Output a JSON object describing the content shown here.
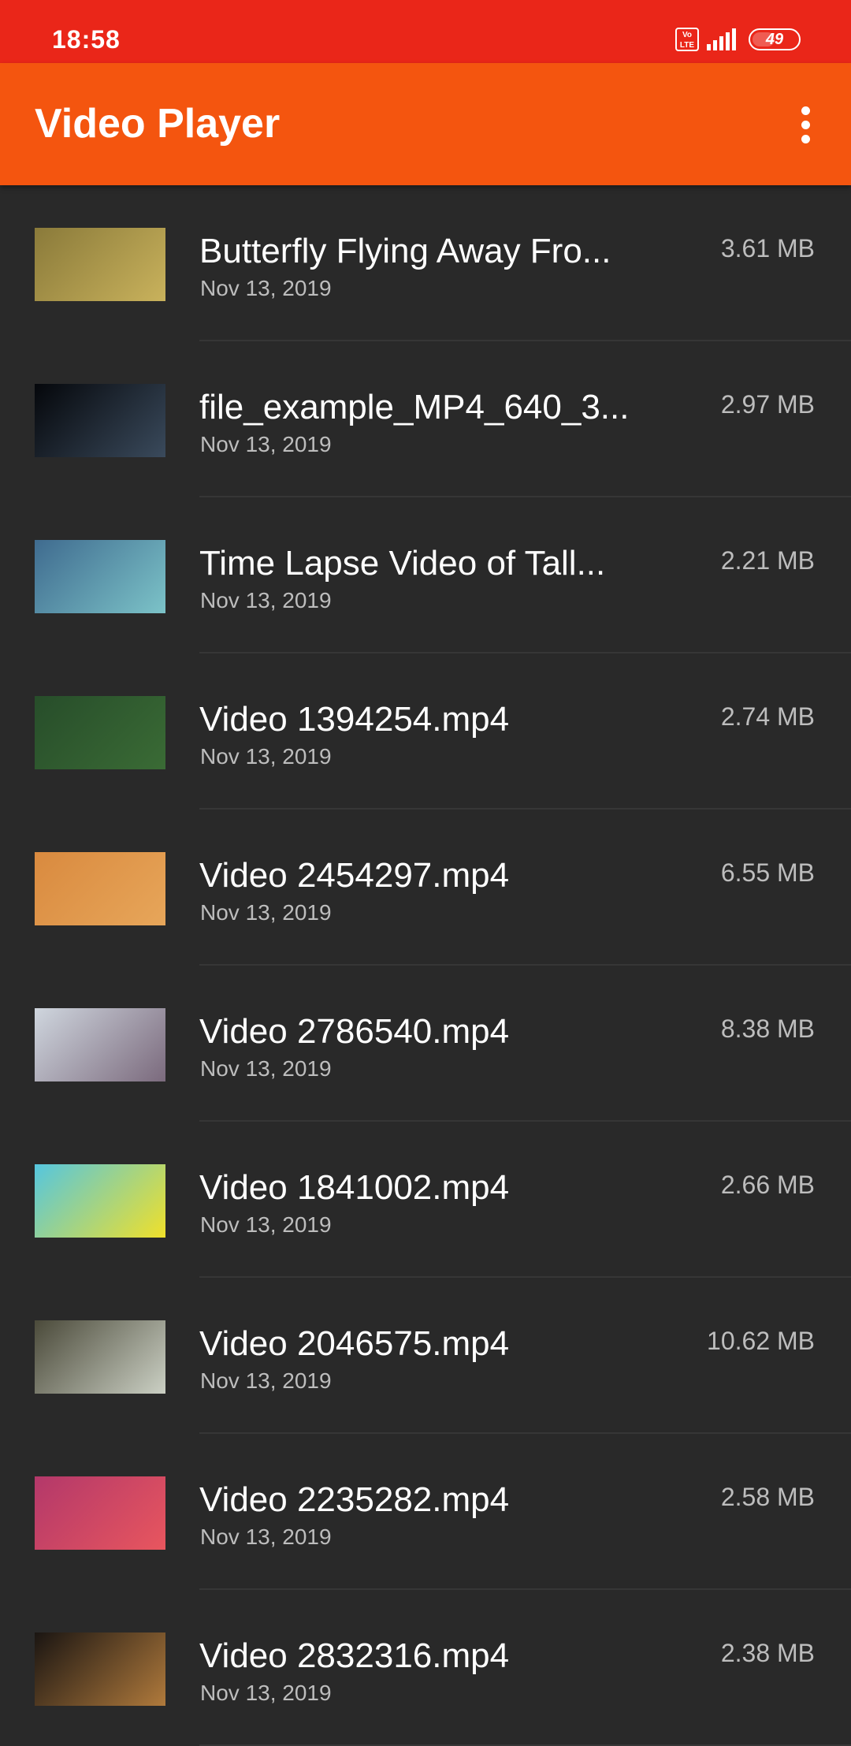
{
  "status_bar": {
    "time": "18:58",
    "volte_label": "Vo LTE",
    "battery_level": "49"
  },
  "app_bar": {
    "title": "Video Player",
    "menu_icon": "more-vert-icon"
  },
  "videos": [
    {
      "title": "Butterfly Flying Away Fro...",
      "date": "Nov 13, 2019",
      "size": "3.61 MB",
      "thumb_colors": [
        "#8a7a3a",
        "#c9b25c"
      ]
    },
    {
      "title": "file_example_MP4_640_3...",
      "date": "Nov 13, 2019",
      "size": "2.97 MB",
      "thumb_colors": [
        "#05070b",
        "#3a4a5c"
      ]
    },
    {
      "title": "Time Lapse Video of Tall...",
      "date": "Nov 13, 2019",
      "size": "2.21 MB",
      "thumb_colors": [
        "#3f6b8f",
        "#7cc3c8"
      ]
    },
    {
      "title": "Video 1394254.mp4",
      "date": "Nov 13, 2019",
      "size": "2.74 MB",
      "thumb_colors": [
        "#274d2a",
        "#3a6b35"
      ]
    },
    {
      "title": "Video 2454297.mp4",
      "date": "Nov 13, 2019",
      "size": "6.55 MB",
      "thumb_colors": [
        "#d98a3f",
        "#e7a65a"
      ]
    },
    {
      "title": "Video 2786540.mp4",
      "date": "Nov 13, 2019",
      "size": "8.38 MB",
      "thumb_colors": [
        "#cfd6de",
        "#7b6a7d"
      ]
    },
    {
      "title": "Video 1841002.mp4",
      "date": "Nov 13, 2019",
      "size": "2.66 MB",
      "thumb_colors": [
        "#55c6df",
        "#f0e02a"
      ]
    },
    {
      "title": "Video 2046575.mp4",
      "date": "Nov 13, 2019",
      "size": "10.62 MB",
      "thumb_colors": [
        "#4b4a3a",
        "#cbd0c4"
      ]
    },
    {
      "title": "Video 2235282.mp4",
      "date": "Nov 13, 2019",
      "size": "2.58 MB",
      "thumb_colors": [
        "#b3386a",
        "#e8565e"
      ]
    },
    {
      "title": "Video 2832316.mp4",
      "date": "Nov 13, 2019",
      "size": "2.38 MB",
      "thumb_colors": [
        "#1a1512",
        "#b07a3c"
      ]
    }
  ]
}
